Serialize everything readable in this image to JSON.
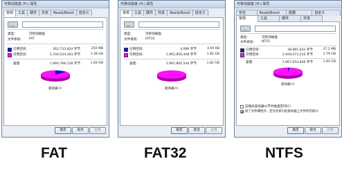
{
  "dialogs": [
    {
      "title": "可移动磁盘 (H:) 属性",
      "tabs": [
        "常规",
        "工具",
        "硬件",
        "共享",
        "ReadyBoost",
        "自定义"
      ],
      "active_tab": 0,
      "type_label": "类型:",
      "type_value": "可移动磁盘",
      "fs_label": "文件系统:",
      "fs_value": "FAT",
      "used_label": "已用空间:",
      "used_bytes": "262,733,824 字节",
      "used_size": "250 MB",
      "free_label": "可用空间:",
      "free_bytes": "1,704,034,304 字节",
      "free_size": "1.58 GB",
      "cap_label": "容量:",
      "cap_bytes": "1,966,768,128 字节",
      "cap_size": "1.83 GB",
      "drive_label": "驱动器 H:",
      "used_fraction": 0.134,
      "ok": "确定",
      "cancel": "取消",
      "apply": "应用"
    },
    {
      "title": "可移动磁盘 (H:) 属性",
      "tabs": [
        "常规",
        "工具",
        "硬件",
        "共享",
        "ReadyBoost",
        "自定义"
      ],
      "active_tab": 0,
      "type_label": "类型:",
      "type_value": "可移动磁盘",
      "fs_label": "文件系统:",
      "fs_value": "FAT32",
      "used_label": "已用空间:",
      "used_bytes": "4,096 字节",
      "used_size": "4.00 KB",
      "free_label": "可用空间:",
      "free_bytes": "1,962,856,448 字节",
      "free_size": "1.82 GB",
      "cap_label": "容量:",
      "cap_bytes": "1,962,860,544 字节",
      "cap_size": "1.82 GB",
      "drive_label": "驱动器 H:",
      "used_fraction": 0.0,
      "ok": "确定",
      "cancel": "取消",
      "apply": "应用"
    },
    {
      "title": "可移动磁盘 (H:) 属性",
      "tabs_row1": [
        "安全",
        "ReadyBoost",
        "配额",
        "自定义"
      ],
      "tabs": [
        "常规",
        "工具",
        "硬件",
        "共享"
      ],
      "active_tab": 0,
      "type_label": "类型:",
      "type_value": "可移动磁盘",
      "fs_label": "文件系统:",
      "fs_value": "NTFS",
      "used_label": "已用空间:",
      "used_bytes": "38,981,632 字节",
      "used_size": "37.1 MB",
      "free_label": "可用空间:",
      "free_bytes": "1,928,073,216 字节",
      "free_size": "1.79 GB",
      "cap_label": "容量:",
      "cap_bytes": "1,967,054,848 字节",
      "cap_size": "1.83 GB",
      "drive_label": "驱动器 H:",
      "compress_label": "压缩此驱动器以节约磁盘空间(C)",
      "index_label": "除了文件属性外，还允许索引此驱动器上文件的内容(I)",
      "used_fraction": 0.02,
      "ok": "确定",
      "cancel": "取消",
      "apply": "应用"
    }
  ],
  "fs_captions": [
    "FAT",
    "FAT32",
    "NTFS"
  ],
  "colors": {
    "used": "#1515d8",
    "free": "#ff10ff",
    "used_dark": "#0a0a8c",
    "free_dark": "#b000b0"
  }
}
